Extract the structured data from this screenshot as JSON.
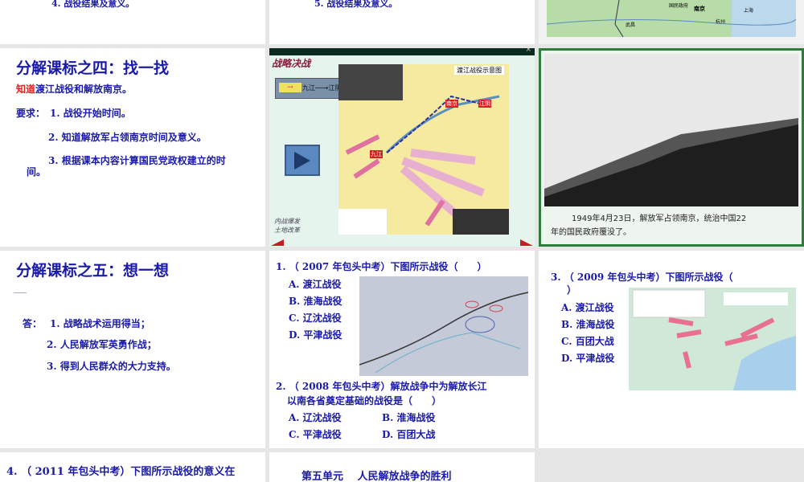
{
  "slides": {
    "s1": {
      "line": "4. 战役结果及意义。"
    },
    "s2": {
      "line": "5. 战役结果及意义。"
    },
    "s3": {
      "labels": [
        "国民政府",
        "南京",
        "上海",
        "武昌",
        "杭州"
      ]
    },
    "s4": {
      "title": "分解课标之四：找一找",
      "intro_red": "知道",
      "intro_rest": "渡江战役和解放南京。",
      "req_label": "要求：",
      "items": [
        "1. 战役开始时间。",
        "2. 知道解放军占领南京时间及意义。",
        "3. 根据课本内容计算国民党政权建立的时",
        "间。"
      ]
    },
    "s5": {
      "header": "战略决战",
      "route": "九江──→江阴",
      "map_title": "渡江战役示意图",
      "cities": [
        "南京",
        "江阴",
        "九江"
      ],
      "side_links": [
        "内战爆发",
        "土地改革"
      ]
    },
    "s6": {
      "caption_1": "1949年4月23日，解放军占领南京，统治中国22",
      "caption_2": "年的国民政府覆没了。"
    },
    "s7": {
      "title": "分解课标之五：想一想",
      "answer_label": "答：",
      "items": [
        "1. 战略战术运用得当；",
        "2. 人民解放军英勇作战；",
        "3. 得到人民群众的大力支持。"
      ]
    },
    "s8": {
      "q1": "1. （ 2007 年包头中考）下图所示战役（　　）",
      "q1_options": [
        "A. 渡江战役",
        "B. 淮海战役",
        "C. 辽沈战役",
        "D. 平津战役"
      ],
      "q2_line1": "2. （ 2008 年包头中考）解放战争中为解放长江",
      "q2_line2": "以南各省奠定基础的战役是（　　）",
      "q2_options": [
        "A. 辽沈战役",
        "B. 淮海战役",
        "C. 平津战役",
        "D. 百团大战"
      ]
    },
    "s9": {
      "q3_line1": "3. （ 2009 年包头中考）下图所示战役（",
      "q3_line2": "）",
      "options": [
        "A. 渡江战役",
        "B. 淮海战役",
        "C. 百团大战",
        "D. 平津战役"
      ]
    },
    "s10": {
      "q4": "4. （ 2011 年包头中考）下图所示战役的意义在"
    },
    "s11": {
      "title": "第五单元　 人民解放战争的胜利"
    }
  },
  "colors": {
    "text_blue": "#1a1aa8",
    "accent_red": "#e02020",
    "border_green": "#2e7d3a"
  }
}
